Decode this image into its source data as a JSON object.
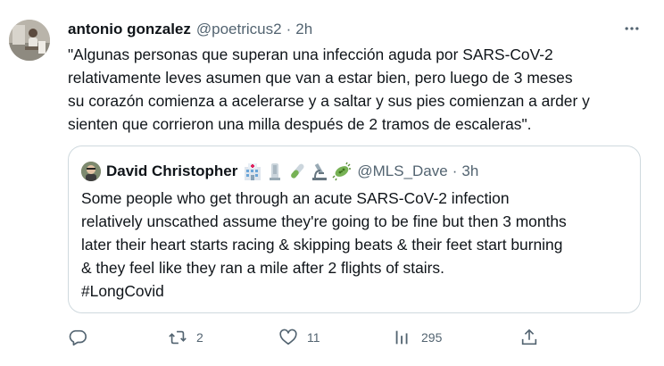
{
  "tweet": {
    "author_name": "antonio gonzalez",
    "author_handle": "@poetricus2",
    "separator": "·",
    "time": "2h",
    "text_lines": [
      "\"Algunas personas que superan una infección aguda por SARS-CoV-2",
      "relativamente leves asumen que van a estar bien, pero luego de 3 meses",
      "su corazón comienza a acelerarse y a saltar y sus pies comienzan a arder y",
      "sienten que corrieron una milla después de 2 tramos de escaleras\"."
    ],
    "more_icon": "more-horizontal-icon"
  },
  "quoted": {
    "author_name": "David Christopher",
    "author_emojis": [
      "hospital-emoji",
      "microscope-stand-emoji",
      "test-tube-emoji",
      "microscope-emoji",
      "microbe-emoji"
    ],
    "author_handle": "@MLS_Dave",
    "separator": "·",
    "time": "3h",
    "text_lines": [
      "Some people who get through an acute SARS-CoV-2 infection",
      "relatively unscathed assume they're going to be fine but then 3 months",
      "later their heart starts racing & skipping beats & their feet start burning",
      "& they feel like they ran a mile after 2 flights of stairs.",
      "#LongCovid"
    ]
  },
  "actions": {
    "reply": {
      "icon": "reply-icon",
      "count": ""
    },
    "retweet": {
      "icon": "retweet-icon",
      "count": "2"
    },
    "like": {
      "icon": "heart-icon",
      "count": "11"
    },
    "views": {
      "icon": "views-icon",
      "count": "295"
    },
    "share": {
      "icon": "share-icon",
      "count": ""
    }
  },
  "colors": {
    "text": "#0f1419",
    "secondary": "#536471",
    "border": "#cfd9de",
    "background": "#ffffff"
  }
}
